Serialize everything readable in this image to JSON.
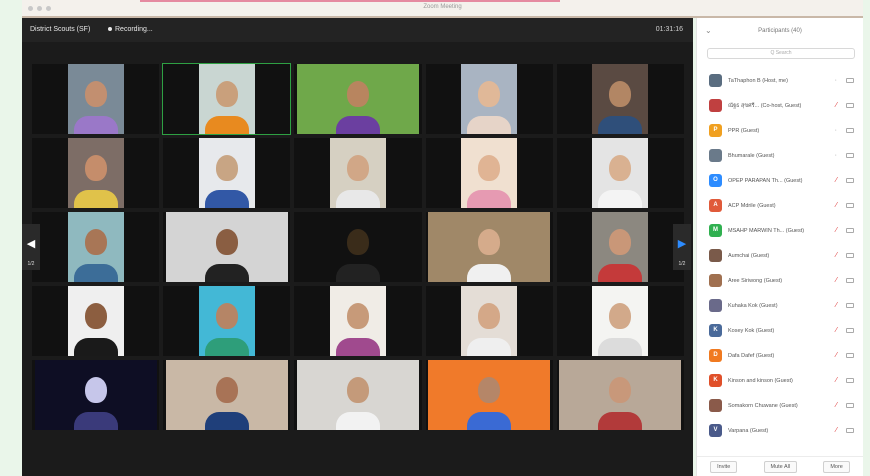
{
  "window": {
    "title": "Zoom Meeting"
  },
  "header": {
    "meeting_name": "District Scouts (SF)",
    "recording_label": "Recording...",
    "timer": "01:31:16"
  },
  "pagination": {
    "prev_page": "1/2",
    "next_page": "1/2"
  },
  "tiles": [
    {
      "bg": "#7a8a97",
      "skin": "#c28f70",
      "shirt": "#9a78c8",
      "wide": false,
      "active": false
    },
    {
      "bg": "#c9d6d2",
      "skin": "#c9a07c",
      "shirt": "#e88a1f",
      "wide": false,
      "active": true
    },
    {
      "bg": "#6fa84a",
      "skin": "#b8855f",
      "shirt": "#6b3fa0",
      "wide": true,
      "active": false
    },
    {
      "bg": "#a9b4c2",
      "skin": "#e0b898",
      "shirt": "#e6d4c8",
      "wide": false,
      "active": false
    },
    {
      "bg": "#5a4a42",
      "skin": "#b28664",
      "shirt": "#2f4f7a",
      "wide": false,
      "active": false
    },
    {
      "bg": "#7d6d66",
      "skin": "#c58d6b",
      "shirt": "#e0c24a",
      "wide": false,
      "active": false
    },
    {
      "bg": "#e7e9ec",
      "skin": "#c8a584",
      "shirt": "#3258a6",
      "wide": false,
      "active": false
    },
    {
      "bg": "#d6d0c2",
      "skin": "#d1a787",
      "shirt": "#e8e8e8",
      "wide": false,
      "active": false
    },
    {
      "bg": "#f0e0d0",
      "skin": "#e0b494",
      "shirt": "#e69ab2",
      "wide": false,
      "active": false
    },
    {
      "bg": "#e4e4e4",
      "skin": "#d9b191",
      "shirt": "#f4f4f4",
      "wide": false,
      "active": false
    },
    {
      "bg": "#8fb9bf",
      "skin": "#a87656",
      "shirt": "#3c6d98",
      "wide": false,
      "active": false
    },
    {
      "bg": "#d4d4d4",
      "skin": "#8a5e42",
      "shirt": "#222222",
      "wide": true,
      "active": false
    },
    {
      "bg": "#111111",
      "skin": "#3a2c1a",
      "shirt": "#222222",
      "wide": false,
      "active": false
    },
    {
      "bg": "#a08868",
      "skin": "#d5ab8b",
      "shirt": "#f0f0f0",
      "wide": true,
      "active": false
    },
    {
      "bg": "#8c8880",
      "skin": "#c99778",
      "shirt": "#c43a3a",
      "wide": false,
      "active": false
    },
    {
      "bg": "#efefef",
      "skin": "#8c5e40",
      "shirt": "#1a1a1a",
      "wide": false,
      "active": false
    },
    {
      "bg": "#43b8d6",
      "skin": "#b58566",
      "shirt": "#2e9e7a",
      "wide": false,
      "active": false
    },
    {
      "bg": "#f0ece6",
      "skin": "#c79a79",
      "shirt": "#a04a8e",
      "wide": false,
      "active": false
    },
    {
      "bg": "#e4ddd6",
      "skin": "#d4a888",
      "shirt": "#efefef",
      "wide": false,
      "active": false
    },
    {
      "bg": "#f4f4f2",
      "skin": "#d2a98a",
      "shirt": "#dcdcdc",
      "wide": false,
      "active": false
    },
    {
      "bg": "#0e0e24",
      "skin": "#c6c6ea",
      "shirt": "#3a3a7a",
      "wide": true,
      "active": false
    },
    {
      "bg": "#c9b8a6",
      "skin": "#a87356",
      "shirt": "#1f3f7a",
      "wide": true,
      "active": false
    },
    {
      "bg": "#d8d6d2",
      "skin": "#c49a7a",
      "shirt": "#f2f2f2",
      "wide": true,
      "active": false
    },
    {
      "bg": "#f07a2a",
      "skin": "#b58668",
      "shirt": "#3a6ad4",
      "wide": true,
      "active": false
    },
    {
      "bg": "#b8a898",
      "skin": "#c8987a",
      "shirt": "#b23a3a",
      "wide": true,
      "active": false
    }
  ],
  "participants_panel": {
    "title": "Participants (40)",
    "search_placeholder": "Q Search",
    "participants": [
      {
        "name": "TaThaphon B (Host, me)",
        "avatar_color": "#5a6d80",
        "initial": "",
        "muted": false
      },
      {
        "name": "ณัฐธ สุขศรี... (Co-host, Guest)",
        "avatar_color": "#c04040",
        "initial": "",
        "muted": true
      },
      {
        "name": "PPR (Guest)",
        "avatar_color": "#f0a020",
        "initial": "P",
        "muted": false
      },
      {
        "name": "Bhumarale (Guest)",
        "avatar_color": "#6a7a8a",
        "initial": "",
        "muted": false
      },
      {
        "name": "OPEP PARAPAN Th... (Guest)",
        "avatar_color": "#2d8cff",
        "initial": "O",
        "muted": true
      },
      {
        "name": "ACP Mdrile (Guest)",
        "avatar_color": "#e05a3a",
        "initial": "A",
        "muted": true
      },
      {
        "name": "MSAHP MARWIN Th... (Guest)",
        "avatar_color": "#30b050",
        "initial": "M",
        "muted": true
      },
      {
        "name": "Aumchai (Guest)",
        "avatar_color": "#7a5a4a",
        "initial": "",
        "muted": true
      },
      {
        "name": "Aree Siriwong (Guest)",
        "avatar_color": "#a07050",
        "initial": "",
        "muted": true
      },
      {
        "name": "Kuhaka Kok (Guest)",
        "avatar_color": "#6a6a8a",
        "initial": "",
        "muted": true
      },
      {
        "name": "Kosey Kok (Guest)",
        "avatar_color": "#4a6a9a",
        "initial": "K",
        "muted": true
      },
      {
        "name": "Dafa Dafef (Guest)",
        "avatar_color": "#f07a20",
        "initial": "D",
        "muted": true
      },
      {
        "name": "Kinson and kinson (Guest)",
        "avatar_color": "#e0502a",
        "initial": "K",
        "muted": true
      },
      {
        "name": "Somakorn Chuwane (Guest)",
        "avatar_color": "#8a5a4a",
        "initial": "",
        "muted": true
      },
      {
        "name": "Varpana (Guest)",
        "avatar_color": "#4a5a8a",
        "initial": "V",
        "muted": true
      }
    ],
    "footer": {
      "invite": "Invite",
      "mute_all": "Mute All",
      "more": "More"
    }
  }
}
